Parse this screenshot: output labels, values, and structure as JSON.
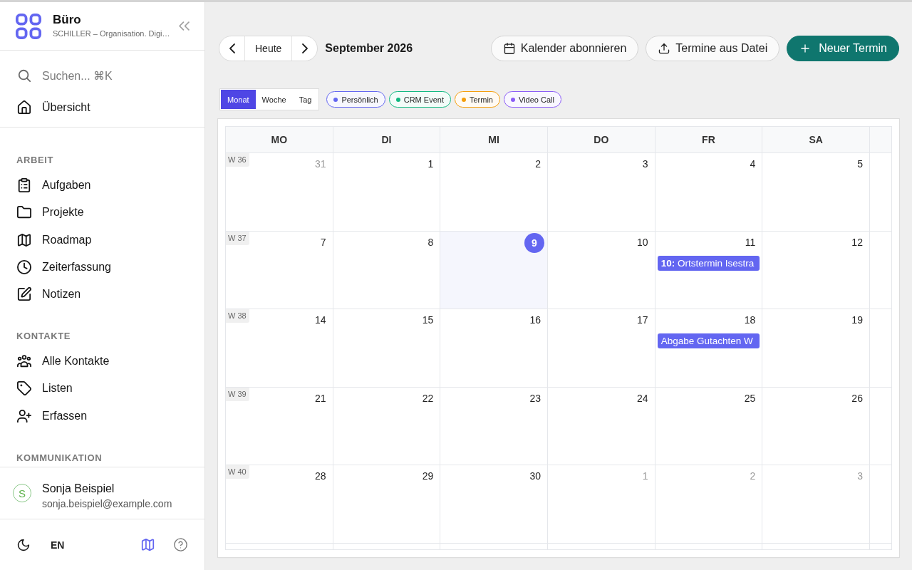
{
  "sidebar": {
    "brand": {
      "title": "Büro",
      "subtitle": "SCHILLER – Organisation. Digi…"
    },
    "search": {
      "label": "Suchen... ⌘K"
    },
    "top_items": [
      {
        "label": "Übersicht"
      }
    ],
    "sections": [
      {
        "title": "ARBEIT",
        "items": [
          {
            "label": "Aufgaben"
          },
          {
            "label": "Projekte"
          },
          {
            "label": "Roadmap"
          },
          {
            "label": "Zeiterfassung"
          },
          {
            "label": "Notizen"
          }
        ]
      },
      {
        "title": "KONTAKTE",
        "items": [
          {
            "label": "Alle Kontakte"
          },
          {
            "label": "Listen"
          },
          {
            "label": "Erfassen"
          }
        ]
      },
      {
        "title": "KOMMUNIKATION"
      }
    ],
    "user": {
      "initial": "S",
      "name": "Sonja Beispiel",
      "email": "sonja.beispiel@example.com"
    },
    "footer": {
      "language": "EN"
    }
  },
  "toolbar": {
    "today": "Heute",
    "month": "September 2026",
    "actions": [
      {
        "label": "Kalender abonnieren",
        "kind": "outline"
      },
      {
        "label": "Termine aus Datei",
        "kind": "outline"
      },
      {
        "label": "Neuer Termin",
        "kind": "primary"
      }
    ]
  },
  "views": [
    {
      "label": "Monat",
      "selected": true
    },
    {
      "label": "Woche",
      "selected": false
    },
    {
      "label": "Tag",
      "selected": false
    }
  ],
  "legend": [
    {
      "label": "Persönlich",
      "color": "#6366f1"
    },
    {
      "label": "CRM Event",
      "color": "#10b981"
    },
    {
      "label": "Termin",
      "color": "#f59e0b"
    },
    {
      "label": "Video Call",
      "color": "#8b5cf6"
    }
  ],
  "calendar": {
    "weekdays": [
      "MO",
      "DI",
      "MI",
      "DO",
      "FR",
      "SA"
    ],
    "weeks": [
      {
        "label": "W 36",
        "days": [
          {
            "day": "31",
            "outside_month": true,
            "today": false
          },
          {
            "day": "1",
            "outside_month": false,
            "today": false
          },
          {
            "day": "2",
            "outside_month": false,
            "today": false
          },
          {
            "day": "3",
            "outside_month": false,
            "today": false
          },
          {
            "day": "4",
            "outside_month": false,
            "today": false
          },
          {
            "day": "5",
            "outside_month": false,
            "today": false
          }
        ]
      },
      {
        "label": "W 37",
        "days": [
          {
            "day": "7",
            "outside_month": false,
            "today": false
          },
          {
            "day": "8",
            "outside_month": false,
            "today": false
          },
          {
            "day": "9",
            "outside_month": false,
            "today": true
          },
          {
            "day": "10",
            "outside_month": false,
            "today": false
          },
          {
            "day": "11",
            "outside_month": false,
            "today": false,
            "events": [
              {
                "text": "**10:** Ortstermin Isestra",
                "color": "#6366f1"
              }
            ]
          },
          {
            "day": "12",
            "outside_month": false,
            "today": false
          }
        ]
      },
      {
        "label": "W 38",
        "days": [
          {
            "day": "14",
            "outside_month": false,
            "today": false
          },
          {
            "day": "15",
            "outside_month": false,
            "today": false
          },
          {
            "day": "16",
            "outside_month": false,
            "today": false
          },
          {
            "day": "17",
            "outside_month": false,
            "today": false
          },
          {
            "day": "18",
            "outside_month": false,
            "today": false,
            "events": [
              {
                "text": "Abgabe Gutachten W",
                "color": "#6366f1"
              }
            ]
          },
          {
            "day": "19",
            "outside_month": false,
            "today": false
          }
        ]
      },
      {
        "label": "W 39",
        "days": [
          {
            "day": "21",
            "outside_month": false,
            "today": false
          },
          {
            "day": "22",
            "outside_month": false,
            "today": false
          },
          {
            "day": "23",
            "outside_month": false,
            "today": false
          },
          {
            "day": "24",
            "outside_month": false,
            "today": false
          },
          {
            "day": "25",
            "outside_month": false,
            "today": false
          },
          {
            "day": "26",
            "outside_month": false,
            "today": false
          }
        ]
      },
      {
        "label": "W 40",
        "days": [
          {
            "day": "28",
            "outside_month": false,
            "today": false
          },
          {
            "day": "29",
            "outside_month": false,
            "today": false
          },
          {
            "day": "30",
            "outside_month": false,
            "today": false
          },
          {
            "day": "1",
            "outside_month": true,
            "today": false
          },
          {
            "day": "2",
            "outside_month": true,
            "today": false
          },
          {
            "day": "3",
            "outside_month": true,
            "today": false
          }
        ]
      }
    ]
  }
}
